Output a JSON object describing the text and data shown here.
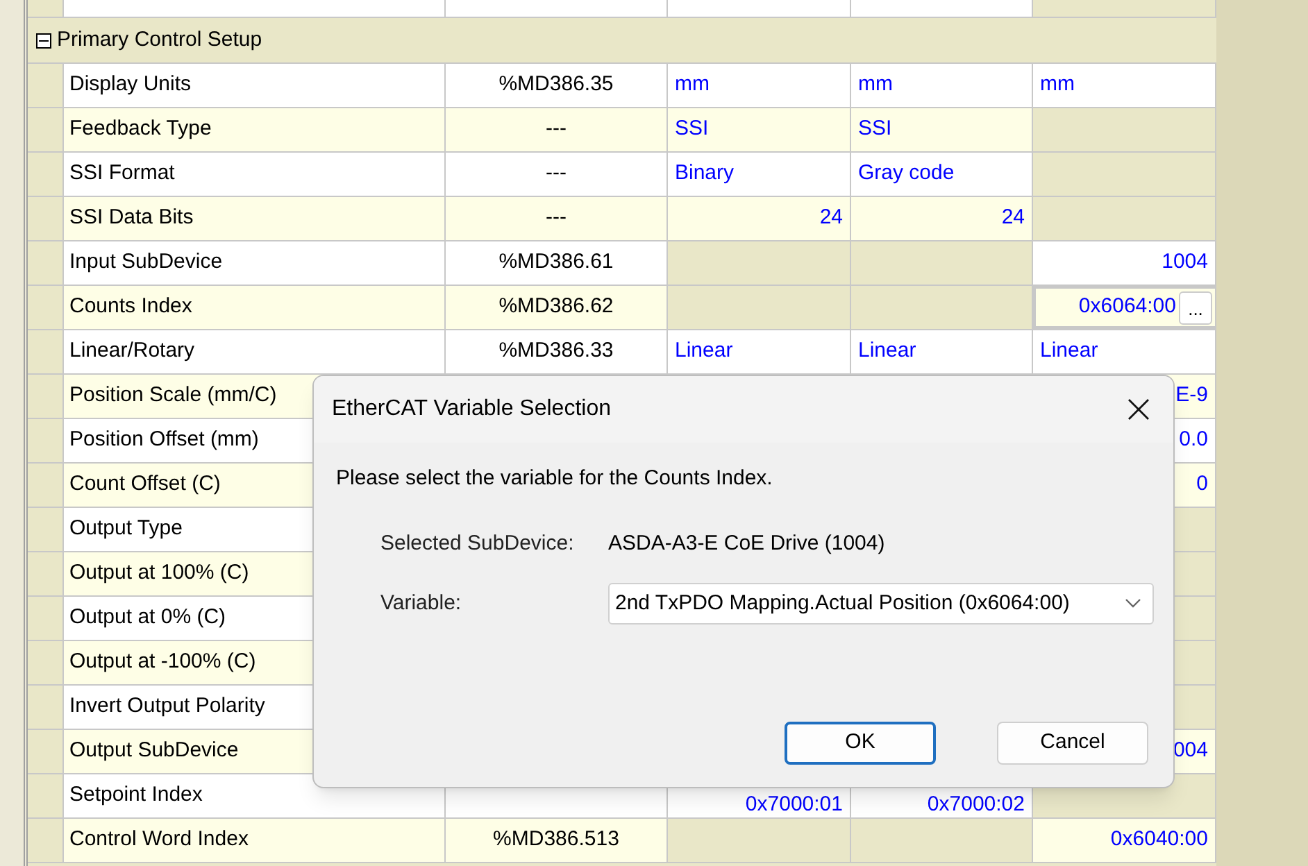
{
  "group": {
    "title": "Primary Control Setup",
    "expanded": true
  },
  "rows": [
    {
      "label": "Display Units",
      "cells": [
        {
          "kind": "address",
          "text": "%MD386.35",
          "disabled": false
        },
        {
          "kind": "text",
          "text": "mm",
          "disabled": false
        },
        {
          "kind": "text",
          "text": "mm",
          "disabled": false
        },
        {
          "kind": "text",
          "text": "mm",
          "disabled": false
        }
      ]
    },
    {
      "label": "Feedback Type",
      "cells": [
        {
          "kind": "address",
          "text": "---",
          "disabled": false
        },
        {
          "kind": "text",
          "text": "SSI",
          "disabled": false
        },
        {
          "kind": "text",
          "text": "SSI",
          "disabled": false
        },
        {
          "kind": "text",
          "disabled": true
        }
      ]
    },
    {
      "label": "SSI Format",
      "cells": [
        {
          "kind": "address",
          "text": "---",
          "disabled": false
        },
        {
          "kind": "text",
          "text": "Binary",
          "disabled": false
        },
        {
          "kind": "text",
          "text": "Gray code",
          "disabled": false
        },
        {
          "kind": "text",
          "disabled": true
        }
      ]
    },
    {
      "label": "SSI Data Bits",
      "cells": [
        {
          "kind": "address",
          "text": "---",
          "disabled": false
        },
        {
          "kind": "number",
          "text": "24",
          "disabled": false
        },
        {
          "kind": "number",
          "text": "24",
          "disabled": false
        },
        {
          "kind": "text",
          "disabled": true
        }
      ]
    },
    {
      "label": "Input SubDevice",
      "cells": [
        {
          "kind": "address",
          "text": "%MD386.61",
          "disabled": false
        },
        {
          "kind": "text",
          "disabled": true
        },
        {
          "kind": "text",
          "disabled": true
        },
        {
          "kind": "number",
          "text": "1004",
          "disabled": false
        }
      ]
    },
    {
      "label": "Counts Index",
      "cells": [
        {
          "kind": "address",
          "text": "%MD386.62",
          "disabled": false
        },
        {
          "kind": "text",
          "disabled": true
        },
        {
          "kind": "text",
          "disabled": true
        },
        {
          "kind": "edit",
          "text": "0x6064:00",
          "button": "...",
          "disabled": false
        }
      ]
    },
    {
      "label": "Linear/Rotary",
      "cells": [
        {
          "kind": "address",
          "text": "%MD386.33",
          "disabled": false
        },
        {
          "kind": "text",
          "text": "Linear",
          "disabled": false
        },
        {
          "kind": "text",
          "text": "Linear",
          "disabled": false
        },
        {
          "kind": "text",
          "text": "Linear",
          "disabled": false
        }
      ]
    },
    {
      "label": "Position Scale (mm/C)",
      "cells": [
        {
          "kind": "address"
        },
        {
          "kind": "text"
        },
        {
          "kind": "text"
        },
        {
          "kind": "number",
          "text": "E-9",
          "disabled": false
        }
      ]
    },
    {
      "label": "Position Offset (mm)",
      "cells": [
        {
          "kind": "address"
        },
        {
          "kind": "text"
        },
        {
          "kind": "text"
        },
        {
          "kind": "number",
          "text": "0.0",
          "disabled": false
        }
      ]
    },
    {
      "label": "Count Offset (C)",
      "cells": [
        {
          "kind": "address"
        },
        {
          "kind": "text"
        },
        {
          "kind": "text"
        },
        {
          "kind": "number",
          "text": "0",
          "disabled": false
        }
      ]
    },
    {
      "label": "Output Type",
      "cells": [
        {
          "kind": "address"
        },
        {
          "kind": "text"
        },
        {
          "kind": "text"
        },
        {
          "kind": "text",
          "disabled": true
        }
      ]
    },
    {
      "label": "Output at 100% (C)",
      "cells": [
        {
          "kind": "address"
        },
        {
          "kind": "text"
        },
        {
          "kind": "text"
        },
        {
          "kind": "text",
          "disabled": true
        }
      ]
    },
    {
      "label": "Output at 0% (C)",
      "cells": [
        {
          "kind": "address"
        },
        {
          "kind": "text"
        },
        {
          "kind": "text"
        },
        {
          "kind": "text",
          "disabled": true
        }
      ]
    },
    {
      "label": "Output at -100% (C)",
      "cells": [
        {
          "kind": "address"
        },
        {
          "kind": "text"
        },
        {
          "kind": "text"
        },
        {
          "kind": "text",
          "disabled": true
        }
      ]
    },
    {
      "label": "Invert Output Polarity",
      "cells": [
        {
          "kind": "address"
        },
        {
          "kind": "text"
        },
        {
          "kind": "text"
        },
        {
          "kind": "text",
          "disabled": true
        }
      ]
    },
    {
      "label": "Output SubDevice",
      "cells": [
        {
          "kind": "address"
        },
        {
          "kind": "text"
        },
        {
          "kind": "text"
        },
        {
          "kind": "number",
          "text": "004",
          "disabled": false
        }
      ]
    },
    {
      "label": "Setpoint Index",
      "cells": [
        {
          "kind": "address"
        },
        {
          "kind": "low",
          "text": "0x7000:01"
        },
        {
          "kind": "low",
          "text": "0x7000:02"
        },
        {
          "kind": "text",
          "disabled": true
        }
      ]
    },
    {
      "label": "Control Word Index",
      "cells": [
        {
          "kind": "address",
          "text": "%MD386.513",
          "disabled": false
        },
        {
          "kind": "text",
          "disabled": true
        },
        {
          "kind": "text",
          "disabled": true
        },
        {
          "kind": "number",
          "text": "0x6040:00",
          "disabled": false
        }
      ]
    }
  ],
  "dialog": {
    "title": "EtherCAT Variable Selection",
    "message": "Please select the variable for the Counts Index.",
    "subdevice_label": "Selected SubDevice:",
    "subdevice_value": "ASDA-A3-E CoE Drive (1004)",
    "variable_label": "Variable:",
    "variable_value": "2nd TxPDO Mapping.Actual Position (0x6064:00)",
    "buttons": [
      {
        "label": "OK",
        "default": true
      },
      {
        "label": "Cancel",
        "default": false
      }
    ]
  }
}
